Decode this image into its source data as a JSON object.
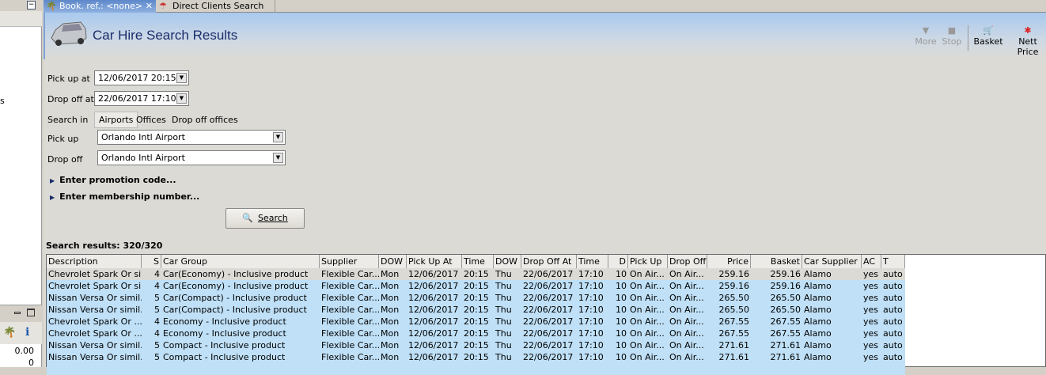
{
  "left": {
    "partial_text": "s",
    "values": [
      "0.00",
      "0"
    ]
  },
  "tabs": [
    {
      "label": "Book. ref.: <none>"
    },
    {
      "label": "Direct Clients Search"
    }
  ],
  "header": {
    "title": "Car Hire Search Results",
    "tools": [
      {
        "label": "More",
        "icon": "triangle-down-icon",
        "enabled": false
      },
      {
        "label": "Stop",
        "icon": "stop-icon",
        "enabled": false
      },
      {
        "label": "Basket",
        "icon": "basket-icon",
        "enabled": true
      },
      {
        "label": "Nett Price",
        "icon": "nett-price-icon",
        "enabled": true
      }
    ]
  },
  "form": {
    "pickup_at_label": "Pick up at",
    "pickup_at": "12/06/2017 20:15",
    "dropoff_at_label": "Drop off at",
    "dropoff_at": "22/06/2017 17:10",
    "search_in_label": "Search in",
    "search_in_options": [
      "Airports",
      "Offices",
      "Drop off offices"
    ],
    "pickup_label": "Pick up",
    "pickup": "Orlando Intl Airport",
    "dropoff_label": "Drop off",
    "dropoff": "Orlando Intl Airport",
    "promo": "Enter promotion code...",
    "membership": "Enter membership number...",
    "search": "Search"
  },
  "results": {
    "title": "Search results: 320/320",
    "columns": [
      "Description",
      "S",
      "Car Group",
      "Supplier",
      "DOW",
      "Pick Up At",
      "Time",
      "DOW",
      "Drop Off At",
      "Time",
      "D",
      "Pick Up",
      "Drop Off",
      "Price",
      "Basket",
      "Car Supplier",
      "AC",
      "T"
    ],
    "rows": [
      [
        "Chevrolet Spark Or si...",
        "4",
        "Car(Economy) - Inclusive product",
        "Flexible Car...",
        "Mon",
        "12/06/2017",
        "20:15",
        "Thu",
        "22/06/2017",
        "17:10",
        "10",
        "On Air...",
        "On Air...",
        "259.16",
        "259.16",
        "Alamo",
        "yes",
        "auto"
      ],
      [
        "Chevrolet Spark Or si...",
        "4",
        "Car(Economy) - Inclusive product",
        "Flexible Car...",
        "Mon",
        "12/06/2017",
        "20:15",
        "Thu",
        "22/06/2017",
        "17:10",
        "10",
        "On Air...",
        "On Air...",
        "259.16",
        "259.16",
        "Alamo",
        "yes",
        "auto"
      ],
      [
        "Nissan Versa Or simil...",
        "5",
        "Car(Compact) - Inclusive product",
        "Flexible Car...",
        "Mon",
        "12/06/2017",
        "20:15",
        "Thu",
        "22/06/2017",
        "17:10",
        "10",
        "On Air...",
        "On Air...",
        "265.50",
        "265.50",
        "Alamo",
        "yes",
        "auto"
      ],
      [
        "Nissan Versa Or simil...",
        "5",
        "Car(Compact) - Inclusive product",
        "Flexible Car...",
        "Mon",
        "12/06/2017",
        "20:15",
        "Thu",
        "22/06/2017",
        "17:10",
        "10",
        "On Air...",
        "On Air...",
        "265.50",
        "265.50",
        "Alamo",
        "yes",
        "auto"
      ],
      [
        "Chevrolet  Spark Or ...",
        "4",
        "Economy - Inclusive product",
        "Flexible Car...",
        "Mon",
        "12/06/2017",
        "20:15",
        "Thu",
        "22/06/2017",
        "17:10",
        "10",
        "On Air...",
        "On Air...",
        "267.55",
        "267.55",
        "Alamo",
        "yes",
        "auto"
      ],
      [
        "Chevrolet  Spark Or ...",
        "4",
        "Economy - Inclusive product",
        "Flexible Car...",
        "Mon",
        "12/06/2017",
        "20:15",
        "Thu",
        "22/06/2017",
        "17:10",
        "10",
        "On Air...",
        "On Air...",
        "267.55",
        "267.55",
        "Alamo",
        "yes",
        "auto"
      ],
      [
        "Nissan Versa Or simil...",
        "5",
        "Compact - Inclusive product",
        "Flexible Car...",
        "Mon",
        "12/06/2017",
        "20:15",
        "Thu",
        "22/06/2017",
        "17:10",
        "10",
        "On Air...",
        "On Air...",
        "271.61",
        "271.61",
        "Alamo",
        "yes",
        "auto"
      ],
      [
        "Nissan Versa Or simil...",
        "5",
        "Compact - Inclusive product",
        "Flexible Car...",
        "Mon",
        "12/06/2017",
        "20:15",
        "Thu",
        "22/06/2017",
        "17:10",
        "10",
        "On Air...",
        "On Air...",
        "271.61",
        "271.61",
        "Alamo",
        "yes",
        "auto"
      ]
    ]
  },
  "colors": {
    "row_selected": "#bfe0f7",
    "row_focus": "#dcdad5",
    "title": "#1a2d6b"
  }
}
